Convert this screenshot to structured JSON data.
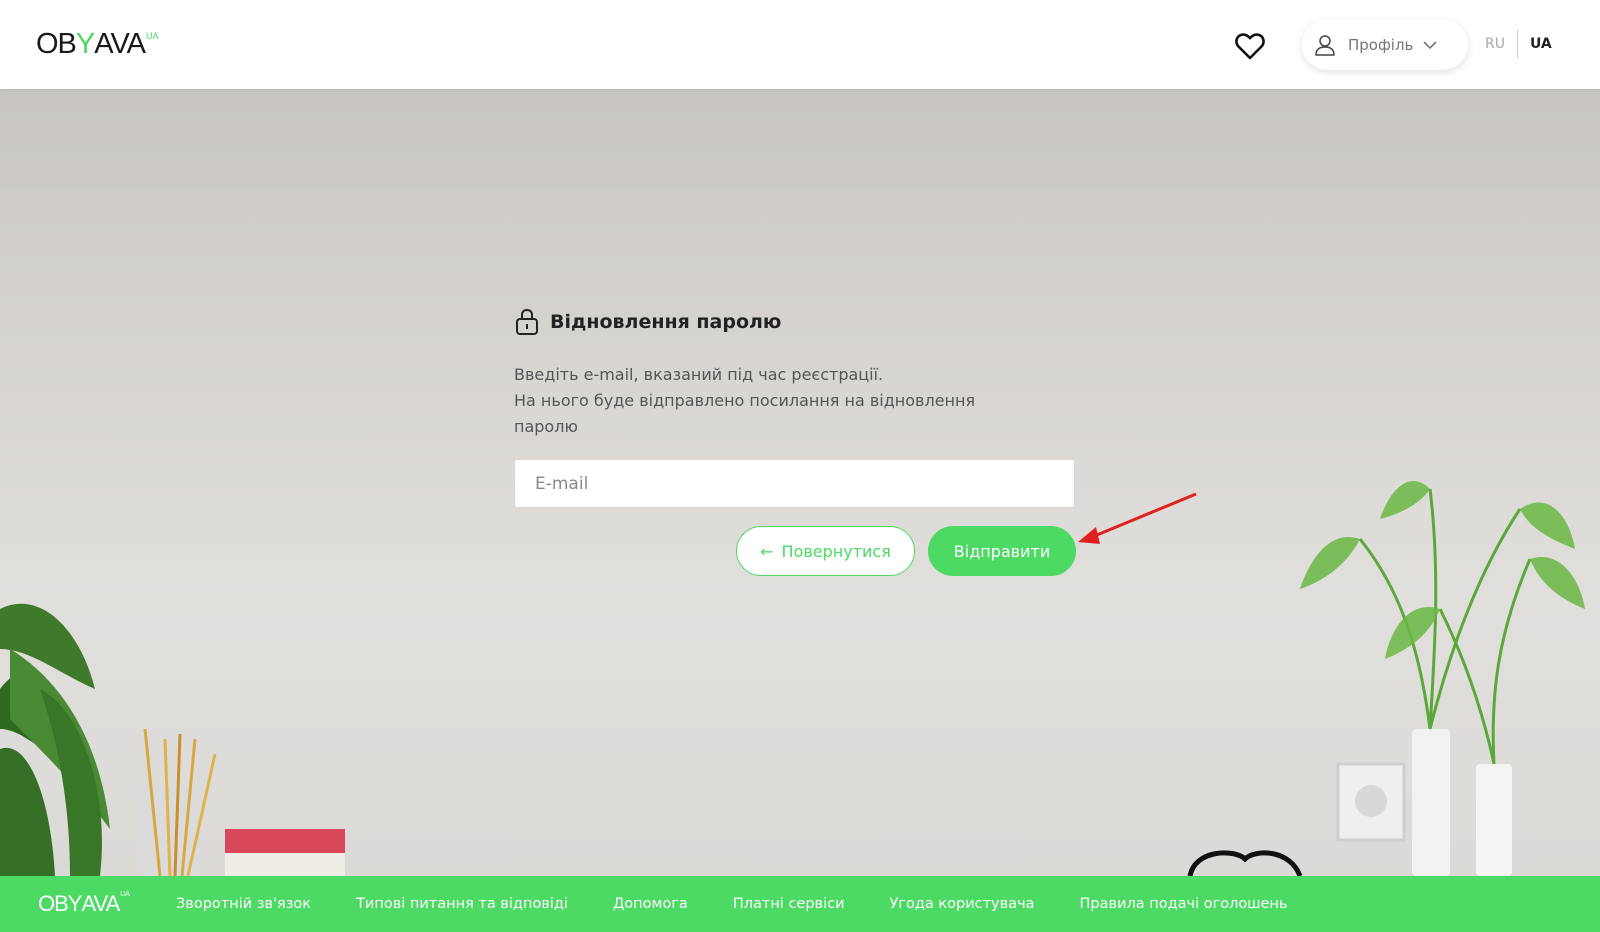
{
  "header": {
    "logo_main_1": "OB",
    "logo_y": "Y",
    "logo_main_2": "AVA",
    "logo_ua": "UA",
    "favorites_icon": "heart-icon",
    "profile_label": "Профіль",
    "lang_ru": "RU",
    "lang_ua": "UA"
  },
  "form": {
    "title": "Відновлення паролю",
    "desc_line1": "Введіть e-mail, вказаний під час реєстрації.",
    "desc_line2": "На нього буде відправлено посилання на відновлення паролю",
    "email_placeholder": "E-mail",
    "email_value": "",
    "back_label": "Повернутися",
    "submit_label": "Відправити"
  },
  "footer": {
    "logo_main_1": "OB",
    "logo_y": "Y",
    "logo_main_2": "AVA",
    "logo_ua": "UA",
    "links": [
      "Зворотній зв'язок",
      "Типові питання та відповіді",
      "Допомога",
      "Платні сервіси",
      "Угода користувача",
      "Правила подачі оголошень"
    ]
  },
  "colors": {
    "accent": "#4cd964",
    "annotation_arrow": "#e02020"
  }
}
